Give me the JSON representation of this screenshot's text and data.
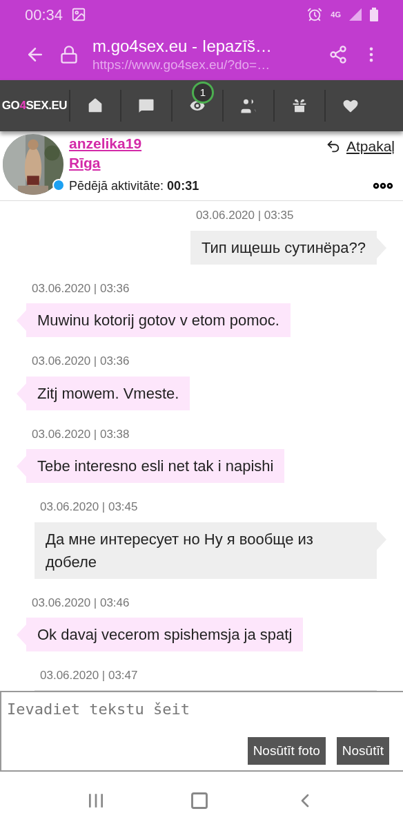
{
  "status_bar": {
    "time": "00:34",
    "network": "4G"
  },
  "browser": {
    "title": "m.go4sex.eu - Iepazīš…",
    "url": "https://www.go4sex.eu/?do=…"
  },
  "logo": {
    "prefix": "GO",
    "mark": "4",
    "suffix": "SEX.EU"
  },
  "nav": [
    {
      "kind": "home"
    },
    {
      "kind": "messages"
    },
    {
      "kind": "views",
      "badge": "1"
    },
    {
      "kind": "friends"
    },
    {
      "kind": "gifts"
    },
    {
      "kind": "favorites"
    }
  ],
  "profile": {
    "username": "anzelika19",
    "city": "Rīga",
    "online": true,
    "activity_label": "Pēdējā aktivitāte:",
    "activity_time": "00:31",
    "back": "Atpakaļ"
  },
  "messages": [
    {
      "kind": "sent",
      "time": "03.06.2020 | 03:35",
      "text": "Тип ищешь сутинёра??"
    },
    {
      "kind": "received",
      "time": "03.06.2020 | 03:36",
      "text": "Muwinu kotorij gotov v etom pomoc."
    },
    {
      "kind": "received",
      "time": "03.06.2020 | 03:36",
      "text": "Zitj mowem. Vmeste."
    },
    {
      "kind": "received",
      "time": "03.06.2020 | 03:38",
      "text": "Tebe interesno esli net tak i napishi"
    },
    {
      "kind": "sent",
      "time": "03.06.2020 | 03:45",
      "text": "Да мне интересует но Ну я вообще из добеле"
    },
    {
      "kind": "received",
      "time": "03.06.2020 | 03:46",
      "text": "Ok davaj vecerom spishemsja ja spatj"
    },
    {
      "kind": "cut",
      "time": "03.06.2020 | 03:47"
    }
  ],
  "composer": {
    "placeholder": "Ievadiet tekstu šeit",
    "buttons": [
      "Nosūtīt foto",
      "Nosūtīt"
    ]
  }
}
